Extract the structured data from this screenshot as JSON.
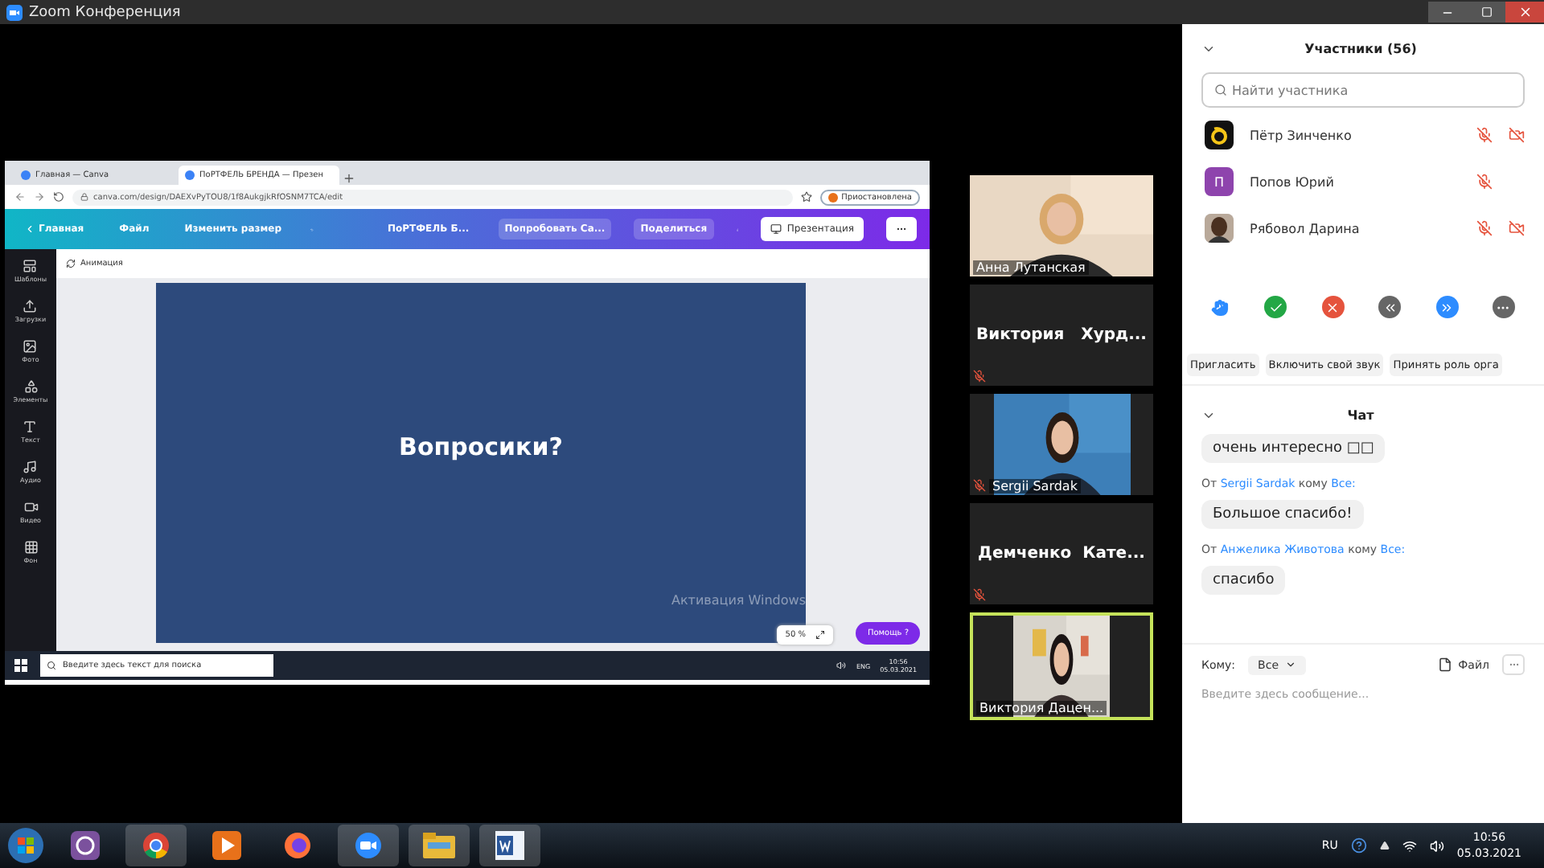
{
  "window": {
    "title": "Zoom Конференция"
  },
  "shared_screen": {
    "browser_tabs": [
      {
        "label": "Главная — Canva",
        "selected": false
      },
      {
        "label": "ПоРТФЕЛЬ БРЕНДА — Презен",
        "selected": true
      }
    ],
    "address": "canva.com/design/DAEXvPyTOU8/1f8AukgjkRfOSNM7TCA/edit",
    "profile_button": "Приостановлена",
    "toolbar": {
      "home": "Главная",
      "file": "Файл",
      "resize": "Изменить размер",
      "design_title": "ПоРТФЕЛЬ Б...",
      "try": "Попробовать Са...",
      "share": "Поделиться",
      "present": "Презентация"
    },
    "animation": "Анимация",
    "side_tools": [
      {
        "label": "Шаблоны",
        "kind": "templates"
      },
      {
        "label": "Загрузки",
        "kind": "uploads"
      },
      {
        "label": "Фото",
        "kind": "photos"
      },
      {
        "label": "Элементы",
        "kind": "elements"
      },
      {
        "label": "Текст",
        "kind": "text"
      },
      {
        "label": "Аудио",
        "kind": "audio"
      },
      {
        "label": "Видео",
        "kind": "video"
      },
      {
        "label": "Фон",
        "kind": "background"
      }
    ],
    "slide_title": "Вопросики?",
    "activation": "Активация Windows",
    "zoom_level": "50 %",
    "help": "Помощь ?",
    "search_placeholder": "Введите здесь текст для поиска",
    "tray": {
      "lang": "ENG",
      "time": "10:56",
      "date": "05.03.2021"
    }
  },
  "video_tiles": [
    {
      "name": "Анна Лутанская",
      "kind": "video",
      "muted": false,
      "active": false
    },
    {
      "name": "Виктория   Хурд...",
      "kind": "name",
      "muted": true,
      "active": false
    },
    {
      "name": "Sergii Sardak",
      "kind": "video",
      "muted": true,
      "active": false
    },
    {
      "name": "Демченко  Кате...",
      "kind": "name",
      "muted": true,
      "active": false
    },
    {
      "name": "Виктория Дацен...",
      "kind": "video",
      "muted": false,
      "active": true
    }
  ],
  "participants": {
    "title": "Участники (56)",
    "search_placeholder": "Найти участника",
    "list": [
      {
        "name": "Пётр Зинченко",
        "kind": "logo",
        "mic_muted": true,
        "video_off": true
      },
      {
        "name": "Попов Юрий",
        "kind": "letter",
        "letter": "П",
        "mic_muted": true,
        "video_off": false
      },
      {
        "name": "Рябовол Дарина",
        "mic_muted": true,
        "video_off": true
      }
    ],
    "buttons": [
      "Пригласить",
      "Включить свой звук",
      "Принять роль орга"
    ]
  },
  "chat": {
    "title": "Чат",
    "messages": [
      {
        "text": "очень интересно □□"
      },
      {
        "prefix": "От",
        "sender": "Sergii Sardak",
        "middle": "кому",
        "recipient": "Все:",
        "text": "Большое спасибо!"
      },
      {
        "prefix": "От",
        "sender": "Анжелика Животова",
        "middle": "кому",
        "recipient": "Все:",
        "text": "спасибо"
      }
    ],
    "to_label": "Кому:",
    "to_value": "Все",
    "file": "Файл",
    "placeholder": "Введите здесь сообщение..."
  },
  "taskbar": {
    "lang": "RU",
    "time": "10:56",
    "date": "05.03.2021"
  }
}
